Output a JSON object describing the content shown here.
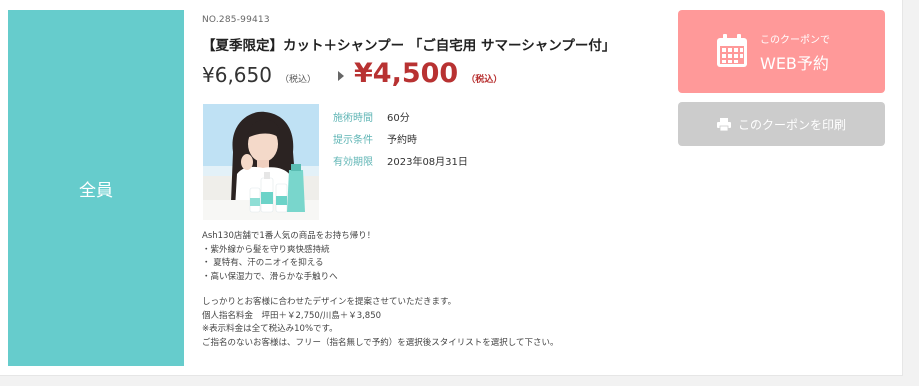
{
  "colors": {
    "target_panel": "#66cccc",
    "web_button": "#ff9999",
    "print_button": "#cccccc",
    "sale_price": "#b83232",
    "info_label": "#5fb5b5"
  },
  "coupon": {
    "target": "全員",
    "number": "NO.285-99413",
    "title": "【夏季限定】カット＋シャンプー 「ご自宅用 サマーシャンプー付」",
    "regular_price": "¥6,650",
    "regular_tax": "（税込）",
    "sale_price": "¥4,500",
    "sale_tax": "（税込）",
    "photo_icon": "model-with-shampoo-bottles-photo",
    "info": [
      {
        "label": "施術時間",
        "value": "60分"
      },
      {
        "label": "提示条件",
        "value": "予約時"
      },
      {
        "label": "有効期限",
        "value": "2023年08月31日"
      }
    ],
    "description": {
      "lines_1": [
        "Ash130店舗で1番人気の商品をお持ち帰り！",
        "・紫外線から髪を守り爽快感持続",
        "・ 夏特有、汗のニオイを抑える",
        "・高い保湿力で、滑らかな手触りへ"
      ],
      "lines_2": [
        "しっかりとお客様に合わせたデザインを提案させていただきます。",
        "個人指名料金　坪田＋￥2,750/川島＋￥3,850",
        "※表示料金は全て税込み10%です。",
        "ご指名のないお客様は、フリー（指名無しで予約）を選択後スタイリストを選択して下さい。"
      ]
    }
  },
  "buttons": {
    "web_small": "このクーポンで",
    "web_big": "WEB予約",
    "web_icon": "calendar-icon",
    "print_label": "このクーポンを印刷",
    "print_icon": "printer-icon"
  }
}
